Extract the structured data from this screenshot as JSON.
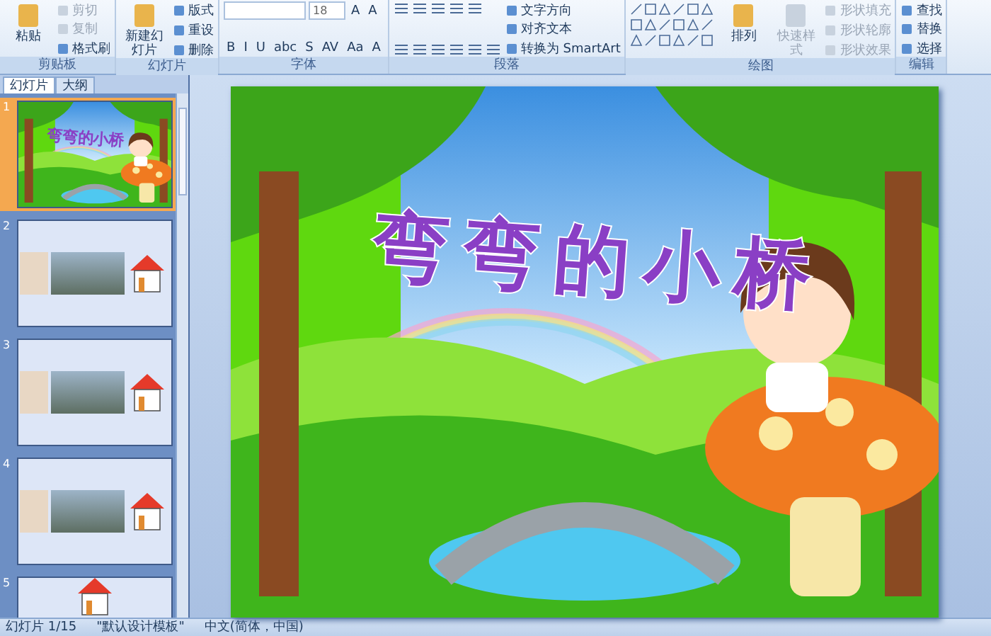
{
  "ribbon": {
    "groups": [
      {
        "label": "剪贴板",
        "columns": [
          [
            {
              "kind": "large",
              "label": "粘贴",
              "disabled": false
            }
          ],
          [
            {
              "kind": "small",
              "label": "剪切",
              "disabled": true
            },
            {
              "kind": "small",
              "label": "复制",
              "disabled": true
            },
            {
              "kind": "small",
              "label": "格式刷",
              "disabled": false
            }
          ]
        ]
      },
      {
        "label": "幻灯片",
        "columns": [
          [
            {
              "kind": "large",
              "label": "新建幻灯片",
              "disabled": false
            }
          ],
          [
            {
              "kind": "small",
              "label": "版式",
              "disabled": false
            },
            {
              "kind": "small",
              "label": "重设",
              "disabled": false
            },
            {
              "kind": "small",
              "label": "删除",
              "disabled": false
            }
          ]
        ]
      },
      {
        "label": "字体",
        "columns": [
          [
            {
              "kind": "font-row",
              "size": "18",
              "glyphs": [
                "A",
                "A"
              ]
            },
            {
              "kind": "glyphs",
              "glyphs": [
                "B",
                "I",
                "U",
                "abc",
                "S",
                "AV",
                "Aa",
                "A"
              ]
            }
          ]
        ]
      },
      {
        "label": "段落",
        "columns": [
          [
            {
              "kind": "list-icons"
            },
            {
              "kind": "align-icons"
            }
          ],
          [
            {
              "kind": "small",
              "label": "文字方向",
              "disabled": false
            },
            {
              "kind": "small",
              "label": "对齐文本",
              "disabled": false
            },
            {
              "kind": "small",
              "label": "转换为 SmartArt",
              "disabled": false
            }
          ]
        ]
      },
      {
        "label": "绘图",
        "columns": [
          [
            {
              "kind": "shapes-gallery"
            }
          ],
          [
            {
              "kind": "large",
              "label": "排列",
              "disabled": false
            }
          ],
          [
            {
              "kind": "large",
              "label": "快速样式",
              "disabled": true
            }
          ],
          [
            {
              "kind": "small",
              "label": "形状填充",
              "disabled": true
            },
            {
              "kind": "small",
              "label": "形状轮廓",
              "disabled": true
            },
            {
              "kind": "small",
              "label": "形状效果",
              "disabled": true
            }
          ]
        ]
      },
      {
        "label": "编辑",
        "columns": [
          [
            {
              "kind": "small",
              "label": "查找",
              "disabled": false
            },
            {
              "kind": "small",
              "label": "替换",
              "disabled": false
            },
            {
              "kind": "small",
              "label": "选择",
              "disabled": false
            }
          ]
        ]
      }
    ]
  },
  "slides_panel": {
    "tabs": [
      {
        "label": "幻灯片",
        "selected": true
      },
      {
        "label": "大纲",
        "selected": false
      }
    ],
    "thumbnails": [
      {
        "number": "1",
        "selected": true,
        "kind": "title",
        "title": "弯弯的小桥"
      },
      {
        "number": "2",
        "selected": false,
        "kind": "picture"
      },
      {
        "number": "3",
        "selected": false,
        "kind": "picture"
      },
      {
        "number": "4",
        "selected": false,
        "kind": "picture"
      },
      {
        "number": "5",
        "selected": false,
        "kind": "partial"
      }
    ]
  },
  "slide": {
    "title": "弯弯的小桥"
  },
  "status_bar": {
    "slide_indicator": "幻灯片 1/15",
    "theme": "\"默认设计模板\"",
    "language": "中文(简体，中国)"
  }
}
